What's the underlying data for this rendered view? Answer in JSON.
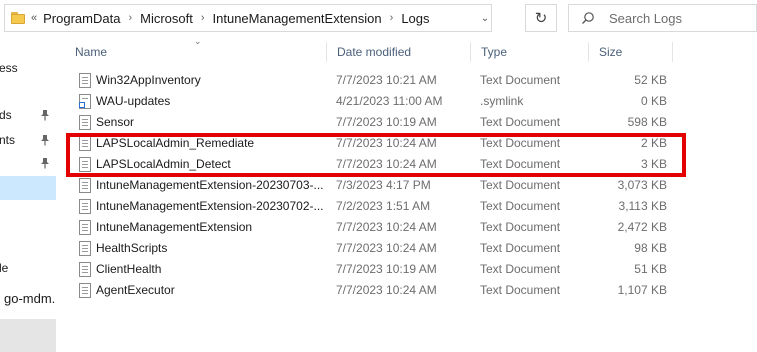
{
  "address_bar": {
    "overflow_chevron": "«",
    "breadcrumbs": [
      "ProgramData",
      "Microsoft",
      "IntuneManagementExtension",
      "Logs"
    ],
    "separator": "›",
    "dropdown_glyph": "⌄",
    "refresh_glyph": "↻"
  },
  "search": {
    "placeholder": "Search Logs"
  },
  "nav": {
    "items": [
      {
        "label": "ess",
        "pinned": false,
        "selected": false
      },
      {
        "label": "ds",
        "pinned": true,
        "selected": false
      },
      {
        "label": "nts",
        "pinned": true,
        "selected": false
      },
      {
        "label": "",
        "pinned": true,
        "selected": false
      },
      {
        "label": "",
        "pinned": false,
        "selected": true
      },
      {
        "label": "le",
        "pinned": false,
        "selected": false
      },
      {
        "label": "go-mdm.",
        "pinned": false,
        "selected": false
      },
      {
        "label": "",
        "pinned": false,
        "selected": false,
        "bottom": true
      }
    ]
  },
  "columns": {
    "name": "Name",
    "date_modified": "Date modified",
    "type": "Type",
    "size": "Size",
    "sort_indicator": "⌄"
  },
  "files": [
    {
      "name": "Win32AppInventory",
      "date": "7/7/2023 10:21 AM",
      "type": "Text Document",
      "size": "52 KB",
      "icon": "text-file-icon"
    },
    {
      "name": "WAU-updates",
      "date": "4/21/2023 11:00 AM",
      "type": ".symlink",
      "size": "0 KB",
      "icon": "symlink-file-icon"
    },
    {
      "name": "Sensor",
      "date": "7/7/2023 10:19 AM",
      "type": "Text Document",
      "size": "598 KB",
      "icon": "text-file-icon"
    },
    {
      "name": "LAPSLocalAdmin_Remediate",
      "date": "7/7/2023 10:24 AM",
      "type": "Text Document",
      "size": "2 KB",
      "icon": "text-file-icon"
    },
    {
      "name": "LAPSLocalAdmin_Detect",
      "date": "7/7/2023 10:24 AM",
      "type": "Text Document",
      "size": "3 KB",
      "icon": "text-file-icon"
    },
    {
      "name": "IntuneManagementExtension-20230703-...",
      "date": "7/3/2023 4:17 PM",
      "type": "Text Document",
      "size": "3,073 KB",
      "icon": "text-file-icon"
    },
    {
      "name": "IntuneManagementExtension-20230702-...",
      "date": "7/2/2023 1:51 AM",
      "type": "Text Document",
      "size": "3,113 KB",
      "icon": "text-file-icon"
    },
    {
      "name": "IntuneManagementExtension",
      "date": "7/7/2023 10:24 AM",
      "type": "Text Document",
      "size": "2,472 KB",
      "icon": "text-file-icon"
    },
    {
      "name": "HealthScripts",
      "date": "7/7/2023 10:24 AM",
      "type": "Text Document",
      "size": "98 KB",
      "icon": "text-file-icon"
    },
    {
      "name": "ClientHealth",
      "date": "7/7/2023 10:19 AM",
      "type": "Text Document",
      "size": "51 KB",
      "icon": "text-file-icon"
    },
    {
      "name": "AgentExecutor",
      "date": "7/7/2023 10:24 AM",
      "type": "Text Document",
      "size": "1,107 KB",
      "icon": "text-file-icon"
    }
  ],
  "annotation": {
    "color": "#e20000",
    "highlighted_files": [
      "LAPSLocalAdmin_Remediate",
      "LAPSLocalAdmin_Detect"
    ]
  },
  "colors": {
    "selection": "#cce8ff",
    "header_text": "#4c607a",
    "folder": "#f5c94e"
  }
}
